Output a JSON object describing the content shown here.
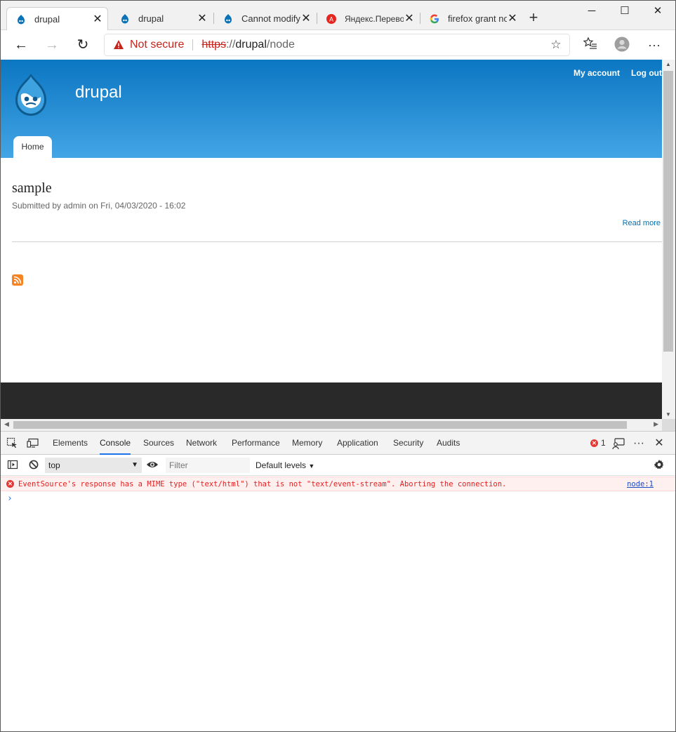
{
  "tabs": [
    {
      "title": "drupal",
      "icon": "drupal-icon",
      "active": true
    },
    {
      "title": "drupal",
      "icon": "drupal-icon"
    },
    {
      "title": "Cannot modify",
      "icon": "drupal-icon"
    },
    {
      "title": "Яндекс.Перево",
      "icon": "yandex-translate-icon"
    },
    {
      "title": "firefox grant no",
      "icon": "google-icon"
    }
  ],
  "address": {
    "security_label": "Not secure",
    "scheme": "https",
    "sep": "://",
    "host": "drupal",
    "path": "/node"
  },
  "site": {
    "name": "drupal",
    "menu": [
      "My account",
      "Log out"
    ],
    "home_tab": "Home"
  },
  "node": {
    "title": "sample",
    "submitted": "Submitted by admin on Fri, 04/03/2020 - 16:02",
    "read_more": "Read more"
  },
  "devtools": {
    "tabs": [
      "Elements",
      "Console",
      "Sources",
      "Network",
      "Performance",
      "Memory",
      "Application",
      "Security",
      "Audits"
    ],
    "active_tab": "Console",
    "error_count": "1",
    "context": "top",
    "filter_placeholder": "Filter",
    "levels": "Default levels",
    "error_message": "EventSource's response has a MIME type (\"text/html\") that is not \"text/event-stream\". Aborting the connection.",
    "error_source": "node:1",
    "prompt": "›"
  },
  "colors": {
    "header_top": "#0b76c2",
    "header_bottom": "#43a5e5",
    "error_red": "#e02020",
    "footer": "#292929"
  }
}
